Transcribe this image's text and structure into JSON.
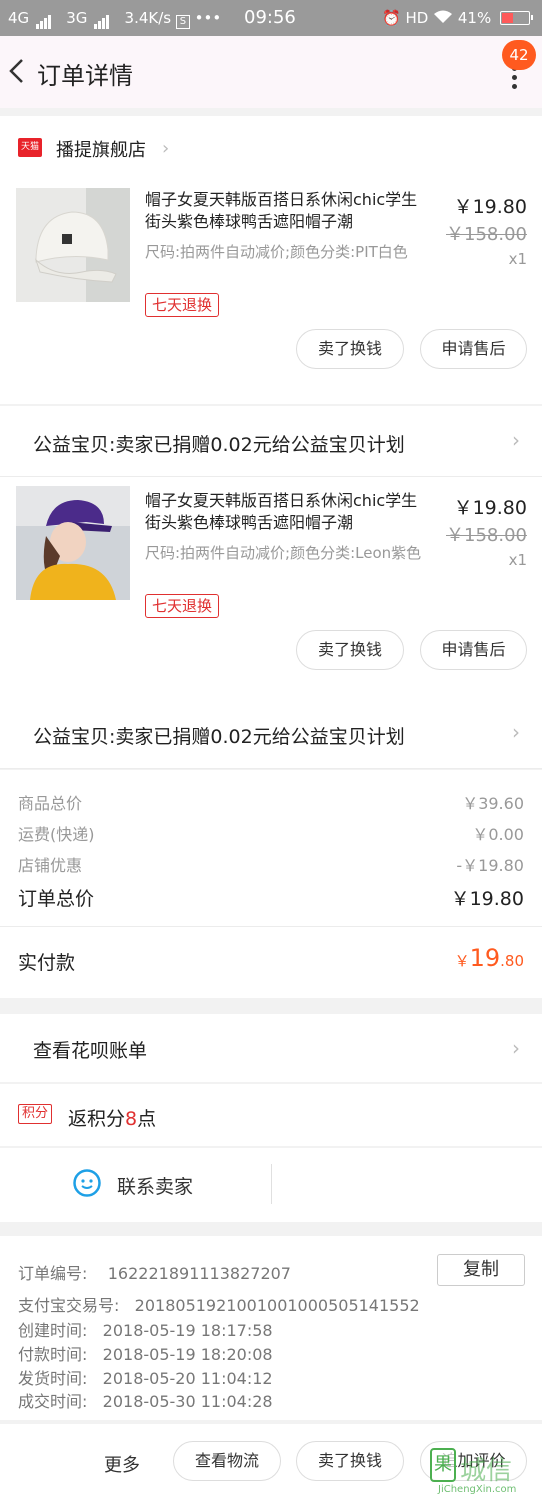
{
  "status_bar": {
    "left": "4G",
    "left2": "3G",
    "speed": "3.4K/s",
    "time": "09:56",
    "hd": "HD",
    "battery": "41%",
    "battery_level": 0.41
  },
  "header": {
    "title": "订单详情",
    "badge": "42"
  },
  "shop": {
    "tmall_label": "天猫",
    "name": "播提旗舰店"
  },
  "items": [
    {
      "title": "帽子女夏天韩版百搭日系休闲chic学生街头紫色棒球鸭舌遮阳帽子潮",
      "sku": "尺码:拍两件自动减价;颜色分类:PIT白色",
      "tag": "七天退换",
      "price": "￥19.80",
      "orig_price": "￥158.00",
      "qty": "x1",
      "btn_resell": "卖了换钱",
      "btn_after_sale": "申请售后",
      "charity": "公益宝贝:卖家已捐赠0.02元给公益宝贝计划"
    },
    {
      "title": "帽子女夏天韩版百搭日系休闲chic学生街头紫色棒球鸭舌遮阳帽子潮",
      "sku": "尺码:拍两件自动减价;颜色分类:Leon紫色",
      "tag": "七天退换",
      "price": "￥19.80",
      "orig_price": "￥158.00",
      "qty": "x1",
      "btn_resell": "卖了换钱",
      "btn_after_sale": "申请售后",
      "charity": "公益宝贝:卖家已捐赠0.02元给公益宝贝计划"
    }
  ],
  "summary": {
    "goods_label": "商品总价",
    "goods_value": "￥39.60",
    "shipping_label": "运费(快递)",
    "shipping_value": "￥0.00",
    "discount_label": "店铺优惠",
    "discount_value": "-￥19.80",
    "total_label": "订单总价",
    "total_value": "￥19.80",
    "paid_label": "实付款",
    "paid_currency": "￥",
    "paid_int": "19",
    "paid_dec": ".80"
  },
  "huabei": {
    "label": "查看花呗账单"
  },
  "points": {
    "tag": "积分",
    "prefix": "返积分",
    "count": "8",
    "suffix": "点"
  },
  "contact": {
    "label": "联系卖家"
  },
  "order_info": {
    "order_no_label": "订单编号:",
    "order_no": "162221891113827207",
    "copy": "复制",
    "alipay_label": "支付宝交易号:",
    "alipay_no": "2018051921001001000505141552",
    "created_label": "创建时间:",
    "created": "2018-05-19 18:17:58",
    "paid_label": "付款时间:",
    "paid": "2018-05-19 18:20:08",
    "shipped_label": "发货时间:",
    "shipped": "2018-05-20 11:04:12",
    "done_label": "成交时间:",
    "done": "2018-05-30 11:04:28"
  },
  "bottom_bar": {
    "more": "更多",
    "logistics": "查看物流",
    "resell": "卖了换钱",
    "review": "追加评价"
  },
  "watermark": {
    "logo": "果",
    "text": "城信",
    "url": "JiChengXin.com"
  },
  "colors": {
    "accent": "#ff5a1f",
    "tag_red": "#e03030",
    "status_bar": "#9a9a9a"
  }
}
